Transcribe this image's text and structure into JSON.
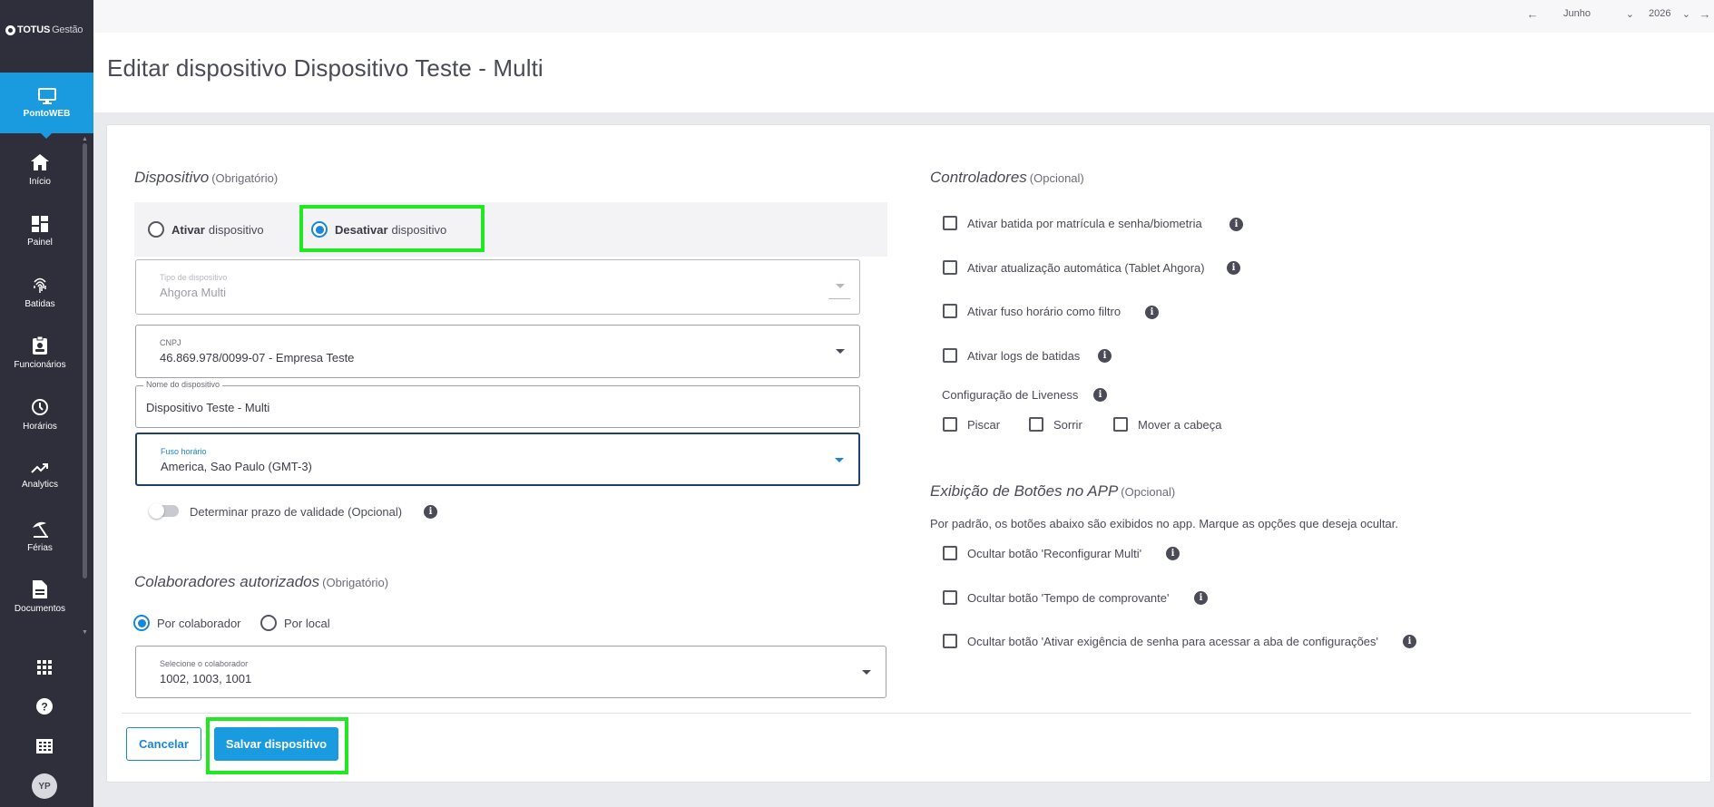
{
  "brand": {
    "name": "TOTUS",
    "suffix": "Gestão"
  },
  "app_tile": {
    "label": "PontoWEB"
  },
  "nav": [
    {
      "id": "inicio",
      "label": "Início",
      "icon": "home-icon"
    },
    {
      "id": "painel",
      "label": "Painel",
      "icon": "dashboard-icon"
    },
    {
      "id": "batidas",
      "label": "Batidas",
      "icon": "fingerprint-icon"
    },
    {
      "id": "funcionarios",
      "label": "Funcionários",
      "icon": "badge-icon"
    },
    {
      "id": "horarios",
      "label": "Horários",
      "icon": "clock-icon"
    },
    {
      "id": "analytics",
      "label": "Analytics",
      "icon": "trending-up-icon"
    },
    {
      "id": "ferias",
      "label": "Férias",
      "icon": "beach-umbrella-icon"
    },
    {
      "id": "documentos",
      "label": "Documentos",
      "icon": "document-icon"
    }
  ],
  "user": {
    "initials": "YP"
  },
  "period": {
    "month": "Junho",
    "year": "2026"
  },
  "page": {
    "title": "Editar dispositivo Dispositivo Teste - Multi"
  },
  "device_section": {
    "title": "Dispositivo",
    "qualifier": "(Obrigatório)",
    "activate": {
      "bold": "Ativar",
      "rest": "dispositivo",
      "selected": false
    },
    "deactivate": {
      "bold": "Desativar",
      "rest": "dispositivo",
      "selected": true
    },
    "device_type": {
      "label": "Tipo de dispositivo",
      "value": "Ahgora Multi"
    },
    "cnpj": {
      "label": "CNPJ",
      "value": "46.869.978/0099-07 - Empresa Teste"
    },
    "device_name": {
      "label": "Nome do dispositivo",
      "value": "Dispositivo Teste - Multi"
    },
    "timezone": {
      "label": "Fuso horário",
      "value": "America, Sao Paulo (GMT-3)"
    },
    "validity_toggle": {
      "label": "Determinar prazo de validade (Opcional)",
      "on": false
    }
  },
  "collaborators_section": {
    "title": "Colaboradores autorizados",
    "qualifier": "(Obrigatório)",
    "by_collaborator": {
      "label": "Por colaborador",
      "selected": true
    },
    "by_location": {
      "label": "Por local",
      "selected": false
    },
    "select": {
      "label": "Selecione o colaborador",
      "value": "1002, 1003, 1001"
    }
  },
  "controllers_section": {
    "title": "Controladores",
    "qualifier": "(Opcional)",
    "options": [
      {
        "label": "Ativar batida por matrícula e senha/biometria",
        "checked": false
      },
      {
        "label": "Ativar atualização automática (Tablet Ahgora)",
        "checked": false
      },
      {
        "label": "Ativar fuso horário como filtro",
        "checked": false
      },
      {
        "label": "Ativar logs de batidas",
        "checked": false
      }
    ],
    "liveness": {
      "label": "Configuração de Liveness",
      "options": [
        {
          "label": "Piscar",
          "checked": false
        },
        {
          "label": "Sorrir",
          "checked": false
        },
        {
          "label": "Mover a cabeça",
          "checked": false
        }
      ]
    }
  },
  "buttons_section": {
    "title": "Exibição de Botões no APP",
    "qualifier": "(Opcional)",
    "description": "Por padrão, os botões abaixo são exibidos no app. Marque as opções que deseja ocultar.",
    "options": [
      {
        "label": "Ocultar botão 'Reconfigurar Multi'",
        "checked": false
      },
      {
        "label": "Ocultar botão 'Tempo de comprovante'",
        "checked": false
      },
      {
        "label": "Ocultar botão 'Ativar exigência de senha para acessar a aba de configurações'",
        "checked": false
      }
    ]
  },
  "actions": {
    "cancel": "Cancelar",
    "save": "Salvar dispositivo"
  },
  "colors": {
    "accent": "#1a9be0",
    "sidebar": "#2e2f3a",
    "highlight": "#22e822"
  }
}
